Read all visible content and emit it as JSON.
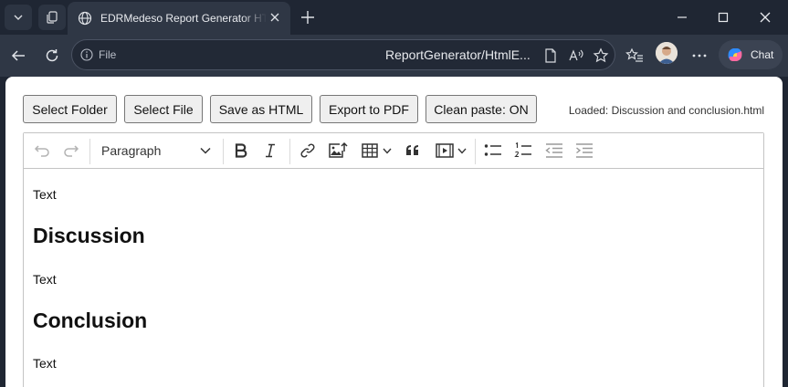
{
  "browser": {
    "tab_title": "EDRMedeso Report Generator HTML",
    "address": {
      "scheme_label": "File",
      "url": "ReportGenerator/HtmlE..."
    },
    "chat_label": "Chat"
  },
  "icons": {
    "tab_list": "chevron-down-icon",
    "workspaces": "workspaces-icon",
    "favicon": "globe-icon",
    "close_tab": "close-icon",
    "new_tab": "plus-icon",
    "minimize": "minimize-icon",
    "maximize": "maximize-icon",
    "close_window": "close-icon",
    "back": "back-arrow-icon",
    "refresh": "refresh-icon",
    "info": "info-icon",
    "reading_view": "document-icon",
    "read_aloud": "read-aloud-icon",
    "favorite": "star-icon",
    "favorites": "favorites-icon",
    "more": "more-icon",
    "copilot": "copilot-icon"
  },
  "app": {
    "buttons": {
      "select_folder": "Select Folder",
      "select_file": "Select File",
      "save_html": "Save as HTML",
      "export_pdf": "Export to PDF",
      "clean_paste": "Clean paste: ON"
    },
    "loaded_status": "Loaded: Discussion and conclusion.html"
  },
  "editor": {
    "heading_select": "Paragraph",
    "content": {
      "p1": "Text",
      "h_discussion": "Discussion",
      "p2": "Text",
      "h_conclusion": "Conclusion",
      "p3": "Text"
    }
  },
  "colors": {
    "chrome_dark": "#1f2633",
    "toolbar_bg": "#2f3745",
    "page_bg": "#ffffff"
  }
}
